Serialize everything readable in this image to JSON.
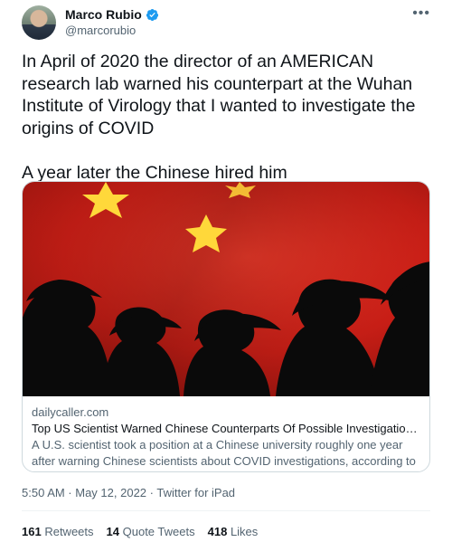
{
  "author": {
    "name": "Marco Rubio",
    "handle": "@marcorubio",
    "verified": true
  },
  "more_icon": "more-horizontal-icon",
  "tweet_text": "In April of 2020 the director of an AMERICAN research lab warned his counterpart at the Wuhan Institute of Virology that I wanted to investigate the origins of COVID\n\nA year later the Chinese hired him",
  "card": {
    "domain": "dailycaller.com",
    "title": "Top US Scientist Warned Chinese Counterparts Of Possible Investigations Into T...",
    "description": "A U.S. scientist took a position at a Chinese university roughly one year after warning Chinese scientists about COVID investigations, according to emails."
  },
  "timestamp": "5:50 AM · May 12, 2022 · Twitter for iPad",
  "stats": {
    "retweets_count": "161",
    "retweets_label": "Retweets",
    "quotes_count": "14",
    "quotes_label": "Quote Tweets",
    "likes_count": "418",
    "likes_label": "Likes"
  },
  "colors": {
    "verified_blue": "#1d9bf0",
    "flag_red": "#d7261c",
    "flag_star": "#ffd83a",
    "secondary_text": "#536471"
  }
}
